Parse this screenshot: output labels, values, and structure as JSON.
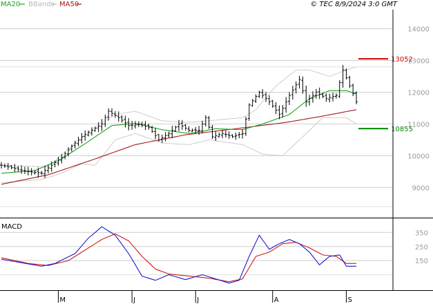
{
  "header": {
    "legend": [
      {
        "label": "MA20",
        "color": "#1aa31a"
      },
      {
        "label": "BBands",
        "color": "#b8b8b8"
      },
      {
        "label": "MA50",
        "color": "#a31a1a"
      }
    ],
    "timestamp": "© TEC 8/9/2024 3:0 GMT"
  },
  "chart_data": [
    {
      "type": "line",
      "panel": "price",
      "title": "",
      "ylim": [
        8050,
        14600
      ],
      "yticks": [
        9000,
        10000,
        11000,
        12000,
        13000,
        14000
      ],
      "ytick_labels": [
        "9000",
        "10000",
        "11000",
        "12000",
        "13000",
        "14000"
      ],
      "grid": true,
      "levels": [
        {
          "label": "13052",
          "value": 13052,
          "color": "#cc0000"
        },
        {
          "label": "10855",
          "value": 10855,
          "color": "#008800"
        }
      ],
      "x_tick_labels": [
        "M",
        "J",
        "J",
        "A",
        "S"
      ],
      "x_tick_index": [
        17,
        39,
        58,
        81,
        103
      ],
      "n_bars": 107,
      "series": [
        {
          "name": "MA20",
          "color": "#1aa31a",
          "anchors": [
            [
              0,
              9450
            ],
            [
              10,
              9530
            ],
            [
              18,
              9900
            ],
            [
              26,
              10450
            ],
            [
              33,
              10950
            ],
            [
              40,
              11020
            ],
            [
              48,
              10820
            ],
            [
              56,
              10700
            ],
            [
              64,
              10850
            ],
            [
              72,
              10820
            ],
            [
              78,
              11000
            ],
            [
              86,
              11300
            ],
            [
              92,
              11800
            ],
            [
              98,
              12050
            ],
            [
              103,
              12050
            ],
            [
              106,
              11950
            ]
          ]
        },
        {
          "name": "MA50",
          "color": "#a31a1a",
          "anchors": [
            [
              0,
              9100
            ],
            [
              14,
              9400
            ],
            [
              28,
              9900
            ],
            [
              40,
              10350
            ],
            [
              55,
              10660
            ],
            [
              70,
              10850
            ],
            [
              85,
              11050
            ],
            [
              95,
              11230
            ],
            [
              106,
              11450
            ]
          ]
        },
        {
          "name": "BBands upper",
          "color": "#c8c8c8",
          "anchors": [
            [
              0,
              9700
            ],
            [
              14,
              9650
            ],
            [
              22,
              10400
            ],
            [
              28,
              10900
            ],
            [
              34,
              11300
            ],
            [
              40,
              11400
            ],
            [
              48,
              11100
            ],
            [
              56,
              11050
            ],
            [
              64,
              11120
            ],
            [
              72,
              11200
            ],
            [
              76,
              11450
            ],
            [
              82,
              12200
            ],
            [
              88,
              12700
            ],
            [
              92,
              12700
            ],
            [
              98,
              12500
            ],
            [
              103,
              12700
            ],
            [
              106,
              12800
            ]
          ]
        },
        {
          "name": "BBands lower",
          "color": "#c8c8c8",
          "anchors": [
            [
              0,
              9150
            ],
            [
              12,
              9250
            ],
            [
              18,
              9450
            ],
            [
              24,
              9750
            ],
            [
              28,
              9700
            ],
            [
              34,
              10500
            ],
            [
              40,
              10700
            ],
            [
              48,
              10400
            ],
            [
              56,
              10350
            ],
            [
              62,
              10500
            ],
            [
              72,
              10350
            ],
            [
              78,
              10050
            ],
            [
              84,
              10000
            ],
            [
              90,
              10600
            ],
            [
              96,
              11200
            ],
            [
              103,
              11200
            ],
            [
              106,
              11000
            ]
          ]
        },
        {
          "name": "Price",
          "color": "#000000",
          "type": "ohlc",
          "anchors": [
            [
              0,
              9700
            ],
            [
              4,
              9600
            ],
            [
              8,
              9500
            ],
            [
              12,
              9450
            ],
            [
              15,
              9700
            ],
            [
              18,
              9950
            ],
            [
              21,
              10300
            ],
            [
              24,
              10600
            ],
            [
              27,
              10800
            ],
            [
              30,
              11000
            ],
            [
              32,
              11400
            ],
            [
              35,
              11200
            ],
            [
              38,
              10950
            ],
            [
              41,
              11000
            ],
            [
              44,
              10900
            ],
            [
              47,
              10500
            ],
            [
              50,
              10700
            ],
            [
              53,
              11000
            ],
            [
              56,
              10800
            ],
            [
              59,
              10800
            ],
            [
              61,
              11200
            ],
            [
              63,
              10600
            ],
            [
              66,
              10700
            ],
            [
              69,
              10600
            ],
            [
              72,
              10700
            ],
            [
              74,
              11600
            ],
            [
              77,
              12000
            ],
            [
              80,
              11700
            ],
            [
              83,
              11300
            ],
            [
              86,
              11900
            ],
            [
              89,
              12400
            ],
            [
              91,
              11700
            ],
            [
              94,
              12000
            ],
            [
              97,
              11800
            ],
            [
              100,
              11900
            ],
            [
              102,
              12700
            ],
            [
              104,
              12200
            ],
            [
              106,
              11700
            ]
          ]
        }
      ]
    },
    {
      "type": "line",
      "panel": "macd",
      "title": "MACD",
      "ylim": [
        -60,
        450
      ],
      "yticks": [
        150,
        250,
        350
      ],
      "ytick_labels": [
        "150",
        "250",
        "350"
      ],
      "grid": true,
      "series": [
        {
          "name": "MACD",
          "color": "#1a1acc",
          "anchors": [
            [
              0,
              160
            ],
            [
              6,
              135
            ],
            [
              12,
              110
            ],
            [
              16,
              130
            ],
            [
              22,
              200
            ],
            [
              26,
              310
            ],
            [
              30,
              390
            ],
            [
              34,
              330
            ],
            [
              38,
              200
            ],
            [
              42,
              40
            ],
            [
              46,
              10
            ],
            [
              50,
              50
            ],
            [
              55,
              15
            ],
            [
              60,
              50
            ],
            [
              64,
              20
            ],
            [
              68,
              -10
            ],
            [
              71,
              10
            ],
            [
              74,
              180
            ],
            [
              77,
              330
            ],
            [
              80,
              230
            ],
            [
              83,
              270
            ],
            [
              86,
              300
            ],
            [
              89,
              270
            ],
            [
              92,
              210
            ],
            [
              95,
              120
            ],
            [
              98,
              180
            ],
            [
              101,
              190
            ],
            [
              103,
              110
            ]
          ]
        },
        {
          "name": "Signal",
          "color": "#cc1a1a",
          "anchors": [
            [
              0,
              170
            ],
            [
              8,
              130
            ],
            [
              14,
              115
            ],
            [
              20,
              150
            ],
            [
              26,
              240
            ],
            [
              30,
              300
            ],
            [
              34,
              340
            ],
            [
              38,
              290
            ],
            [
              42,
              180
            ],
            [
              46,
              90
            ],
            [
              50,
              55
            ],
            [
              56,
              40
            ],
            [
              62,
              25
            ],
            [
              68,
              0
            ],
            [
              72,
              20
            ],
            [
              76,
              180
            ],
            [
              80,
              210
            ],
            [
              84,
              270
            ],
            [
              88,
              280
            ],
            [
              92,
              240
            ],
            [
              96,
              190
            ],
            [
              100,
              180
            ],
            [
              103,
              130
            ]
          ]
        }
      ]
    }
  ]
}
